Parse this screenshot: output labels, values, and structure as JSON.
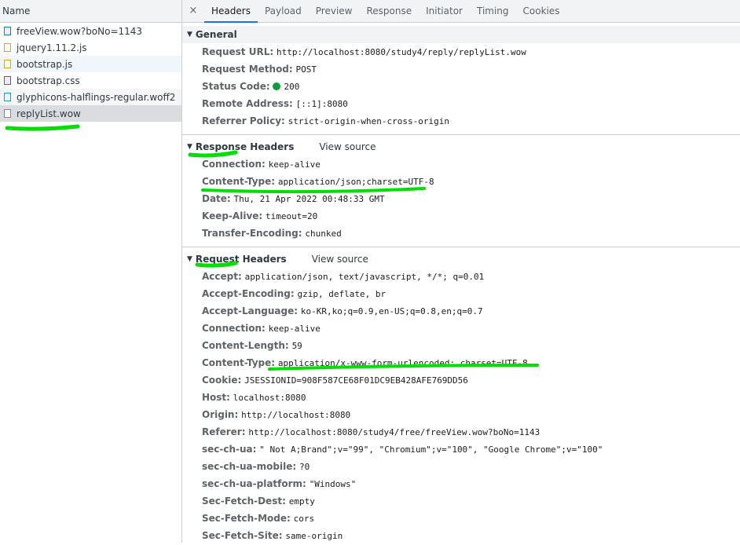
{
  "left_panel": {
    "header": "Name",
    "files": [
      {
        "name": "freeView.wow?boNo=1143",
        "icon": "document-icon"
      },
      {
        "name": "jquery1.11.2.js",
        "icon": "script-file-icon"
      },
      {
        "name": "bootstrap.js",
        "icon": "script-file-icon"
      },
      {
        "name": "bootstrap.css",
        "icon": "stylesheet-file-icon"
      },
      {
        "name": "glyphicons-halflings-regular.woff2",
        "icon": "font-file-icon"
      },
      {
        "name": "replyList.wow",
        "icon": "xhr-file-icon"
      }
    ]
  },
  "tabs": {
    "close": "×",
    "items": [
      "Headers",
      "Payload",
      "Preview",
      "Response",
      "Initiator",
      "Timing",
      "Cookies"
    ],
    "active": "Headers"
  },
  "general": {
    "title": "General",
    "rows": [
      {
        "key": "Request URL:",
        "value": "http://localhost:8080/study4/reply/replyList.wow"
      },
      {
        "key": "Request Method:",
        "value": "POST"
      },
      {
        "key": "Status Code:",
        "value": "200"
      },
      {
        "key": "Remote Address:",
        "value": "[::1]:8080"
      },
      {
        "key": "Referrer Policy:",
        "value": "strict-origin-when-cross-origin"
      }
    ]
  },
  "response_headers": {
    "title": "Response Headers",
    "view_source": "View source",
    "rows": [
      {
        "key": "Connection:",
        "value": "keep-alive"
      },
      {
        "key": "Content-Type:",
        "value": "application/json;charset=UTF-8"
      },
      {
        "key": "Date:",
        "value": "Thu, 21 Apr 2022 00:48:33 GMT"
      },
      {
        "key": "Keep-Alive:",
        "value": "timeout=20"
      },
      {
        "key": "Transfer-Encoding:",
        "value": "chunked"
      }
    ]
  },
  "request_headers": {
    "title": "Request Headers",
    "view_source": "View source",
    "rows": [
      {
        "key": "Accept:",
        "value": "application/json, text/javascript, */*; q=0.01"
      },
      {
        "key": "Accept-Encoding:",
        "value": "gzip, deflate, br"
      },
      {
        "key": "Accept-Language:",
        "value": "ko-KR,ko;q=0.9,en-US;q=0.8,en;q=0.7"
      },
      {
        "key": "Connection:",
        "value": "keep-alive"
      },
      {
        "key": "Content-Length:",
        "value": "59"
      },
      {
        "key": "Content-Type:",
        "value": "application/x-www-form-urlencoded; charset=UTF-8"
      },
      {
        "key": "Cookie:",
        "value": "JSESSIONID=908F587CE68F01DC9EB428AFE769DD56"
      },
      {
        "key": "Host:",
        "value": "localhost:8080"
      },
      {
        "key": "Origin:",
        "value": "http://localhost:8080"
      },
      {
        "key": "Referer:",
        "value": "http://localhost:8080/study4/free/freeView.wow?boNo=1143"
      },
      {
        "key": "sec-ch-ua:",
        "value": "\" Not A;Brand\";v=\"99\", \"Chromium\";v=\"100\", \"Google Chrome\";v=\"100\""
      },
      {
        "key": "sec-ch-ua-mobile:",
        "value": "?0"
      },
      {
        "key": "sec-ch-ua-platform:",
        "value": "\"Windows\""
      },
      {
        "key": "Sec-Fetch-Dest:",
        "value": "empty"
      },
      {
        "key": "Sec-Fetch-Mode:",
        "value": "cors"
      },
      {
        "key": "Sec-Fetch-Site:",
        "value": "same-origin"
      }
    ]
  },
  "colors": {
    "accent": "#1a73e8",
    "status_ok": "#0a9e3c",
    "highlight_marker": "#00e000"
  }
}
